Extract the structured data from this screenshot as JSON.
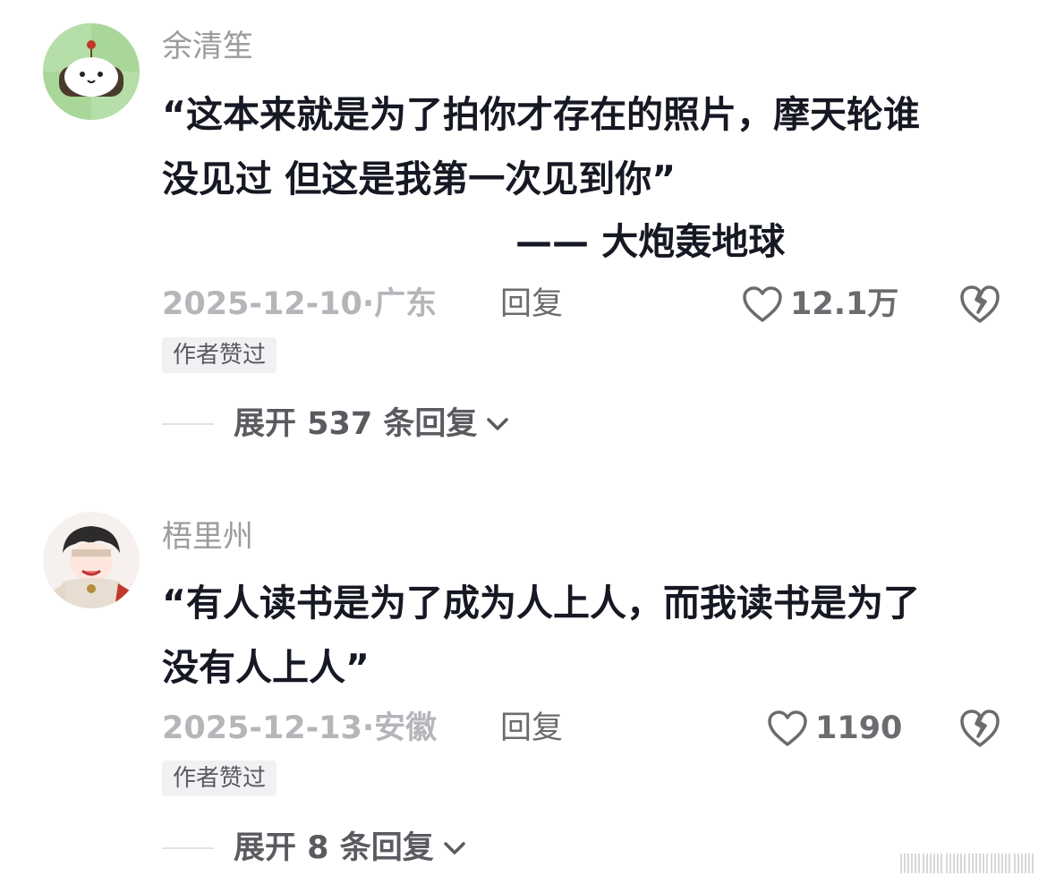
{
  "comments": [
    {
      "username": "余清笙",
      "content_line1": "“这本来就是为了拍你才存在的照片，摩天轮谁",
      "content_line2": "没见过 但这是我第一次见到你”",
      "attribution": "—— 大炮轰地球",
      "date_location": "2025-12-10·广东",
      "reply_label": "回复",
      "like_count": "12.1万",
      "badge": "作者赞过",
      "expand_label": "展开 537 条回复"
    },
    {
      "username": "梧里州",
      "content_line1": "“有人读书是为了成为人上人，而我读书是为了",
      "content_line2": "没有人上人”",
      "date_location": "2025-12-13·安徽",
      "reply_label": "回复",
      "like_count": "1190",
      "badge": "作者赞过",
      "expand_label": "展开 8 条回复"
    }
  ],
  "colors": {
    "primary_text": "#161823",
    "secondary_text": "#9b9ba0",
    "badge_bg": "#f1f1f3"
  }
}
